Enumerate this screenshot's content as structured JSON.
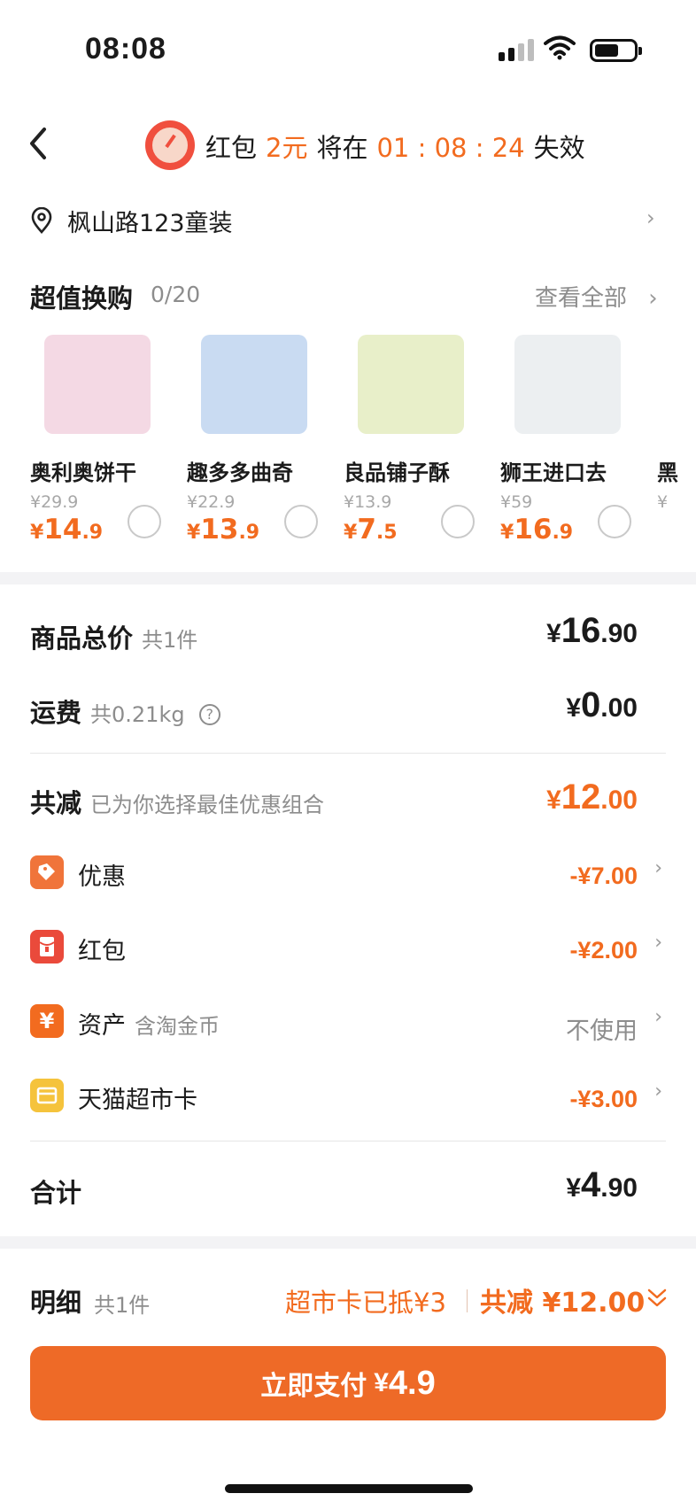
{
  "status_bar": {
    "time": "08:08"
  },
  "header": {
    "timer_prefix": "红包",
    "timer_amount": "2元",
    "timer_middle": "将在",
    "countdown": "01 : 08 : 24",
    "timer_suffix": "失效"
  },
  "address": {
    "text": "枫山路123童装"
  },
  "swap": {
    "title": "超值换购",
    "count": "0/20",
    "see_all": "查看全部",
    "products": [
      {
        "name": "奥利奥饼干",
        "old_price": "¥29.9",
        "price_int": "14",
        "price_dec": ".9",
        "color": "#f4d9e4"
      },
      {
        "name": "趣多多曲奇",
        "old_price": "¥22.9",
        "price_int": "13",
        "price_dec": ".9",
        "color": "#c9dbf2"
      },
      {
        "name": "良品铺子酥",
        "old_price": "¥13.9",
        "price_int": "7",
        "price_dec": ".5",
        "color": "#e8efc9"
      },
      {
        "name": "狮王进口去",
        "old_price": "¥59",
        "price_int": "16",
        "price_dec": ".9",
        "color": "#eceff1"
      },
      {
        "name": "黑",
        "old_price": "¥",
        "price_int": "",
        "price_dec": "",
        "color": "#eeeeee"
      }
    ],
    "currency": "¥"
  },
  "summary": {
    "goods_label": "商品总价",
    "goods_sub": "共1件",
    "goods_int": "16",
    "goods_dec": ".90",
    "shipping_label": "运费",
    "shipping_sub": "共0.21kg",
    "shipping_int": "0",
    "shipping_dec": ".00",
    "reduce_label": "共减",
    "reduce_sub": "已为你选择最佳优惠组合",
    "reduce_int": "12",
    "reduce_dec": ".00",
    "currency": "¥"
  },
  "discounts": [
    {
      "label": "优惠",
      "sub": "",
      "amount": "-¥7.00",
      "icon": "tag-icon",
      "color": "#f0743a"
    },
    {
      "label": "红包",
      "sub": "",
      "amount": "-¥2.00",
      "icon": "red-packet-icon",
      "color": "#ea4a3b"
    },
    {
      "label": "资产",
      "sub": "含淘金币",
      "amount": "不使用",
      "icon": "yuan-icon",
      "color": "#f26b1f"
    },
    {
      "label": "天猫超市卡",
      "sub": "",
      "amount": "-¥3.00",
      "icon": "card-icon",
      "color": "#f5c33c"
    }
  ],
  "total": {
    "label": "合计",
    "int": "4",
    "dec": ".90",
    "currency": "¥"
  },
  "bottom": {
    "detail_label": "明细",
    "detail_sub": "共1件",
    "card_used": "超市卡已抵¥3",
    "total_discount": "共减 ¥12.00",
    "pay_label": "立即支付",
    "pay_currency": "¥",
    "pay_amount": "4.9"
  },
  "colors": {
    "accent": "#f26b1f",
    "pay_button": "#ee6a27"
  }
}
